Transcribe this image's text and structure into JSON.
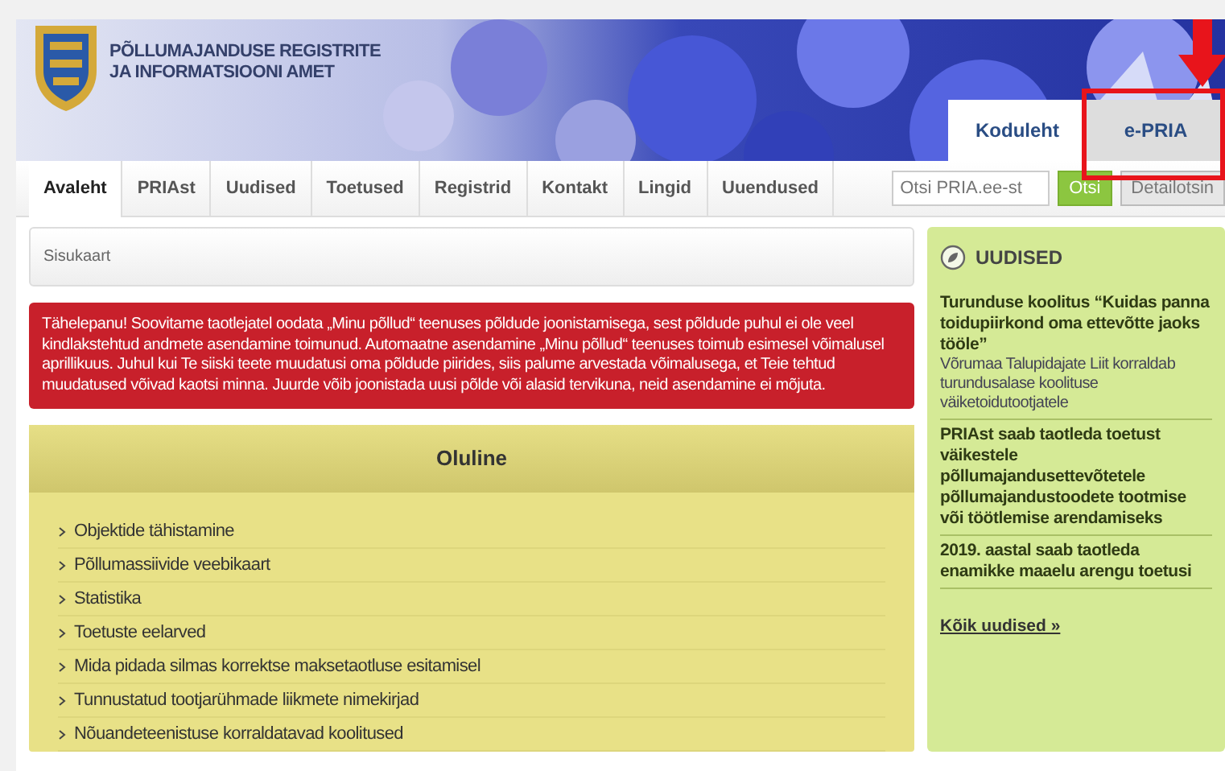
{
  "header": {
    "title_lines": [
      "PÕLLUMAJANDUSE REGISTRITE",
      "JA INFORMATSIOONI AMET"
    ],
    "site_tabs": [
      {
        "label": "Koduleht",
        "selected": true
      },
      {
        "label": "e-PRIA",
        "selected": false,
        "highlighted": true
      }
    ]
  },
  "nav": {
    "items": [
      {
        "label": "Avaleht",
        "selected": true
      },
      {
        "label": "PRIAst",
        "selected": false
      },
      {
        "label": "Uudised",
        "selected": false
      },
      {
        "label": "Toetused",
        "selected": false
      },
      {
        "label": "Registrid",
        "selected": false
      },
      {
        "label": "Kontakt",
        "selected": false
      },
      {
        "label": "Lingid",
        "selected": false
      },
      {
        "label": "Uuendused",
        "selected": false
      }
    ],
    "search": {
      "placeholder": "Otsi PRIA.ee-st"
    },
    "buttons": [
      {
        "label": "Otsi",
        "kind": "primary"
      },
      {
        "label": "Detailotsin",
        "kind": "secondary"
      }
    ]
  },
  "breadcrumb": "Sisukaart",
  "alert": "Tähelepanu! Soovitame taotlejatel oodata „Minu põllud“ teenuses põldude joonistamisega, sest põldude puhul ei ole veel kindlakstehtud andmete asendamine toimunud. Automaatne asendamine „Minu põllud“ teenuses toimub esimesel võimalusel aprillikuus. Juhul kui Te siiski teete muudatusi oma põldude piirides, siis palume arvestada võimalusega, et Teie tehtud muudatused võivad kaotsi minna. Juurde võib joonistada uusi põlde või alasid tervikuna, neid asendamine ei mõjuta.",
  "important": {
    "title": "Oluline",
    "links": [
      "Objektide tähistamine",
      "Põllumassiivide veebikaart",
      "Statistika",
      "Toetuste eelarved",
      "Mida pidada silmas korrektse maksetaotluse esitamisel",
      "Tunnustatud tootjarühmade liikmete nimekirjad",
      "Nõuandeteenistuse korraldatavad koolitused"
    ]
  },
  "news": {
    "title": "UUDISED",
    "items": [
      {
        "title": "Turunduse koolitus “Kuidas panna toidupiirkond oma ettevõtte jaoks tööle”",
        "summary": "Võrumaa Talupidajate Liit korraldab turundusalase koolituse väiketoidutootjatele"
      },
      {
        "title": "PRIAst saab taotleda toetust väikestele põllumajandusettevõtetele põllumajandustoodete tootmise või töötlemise arendamiseks"
      },
      {
        "title": "2019. aastal saab taotleda enamikke maaelu arengu toetusi"
      }
    ],
    "all_link": "Kõik uudised »"
  }
}
